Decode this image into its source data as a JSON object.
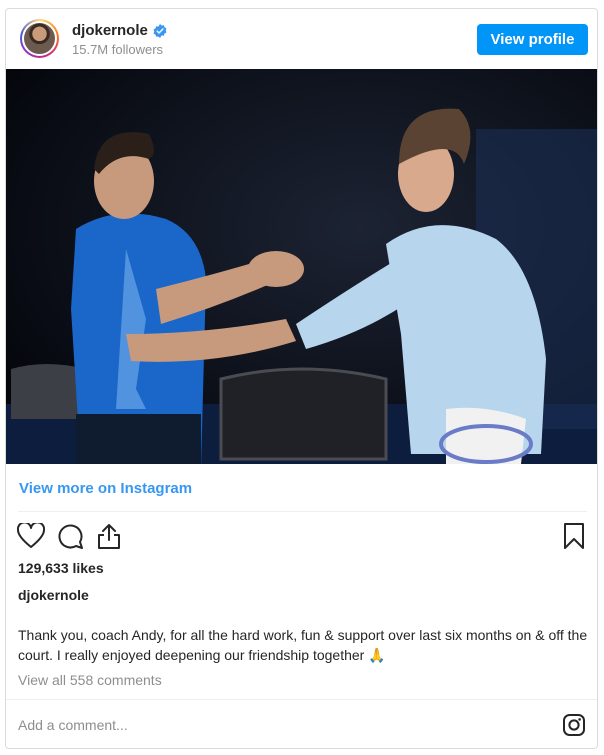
{
  "header": {
    "username": "djokernole",
    "followers": "15.7M followers",
    "view_profile_label": "View profile"
  },
  "post": {
    "view_more_label": "View more on Instagram",
    "likes": "129,633 likes",
    "owner": "djokernole",
    "caption": "Thank you, coach Andy, for all the hard work, fun & support over last six months on & off the court. I really enjoyed deepening our friendship together 🙏",
    "view_comments_label": "View all 558 comments"
  },
  "comment": {
    "placeholder": "Add a comment..."
  },
  "icons": {
    "verified": "verified-badge-icon",
    "like": "heart-icon",
    "comment": "comment-bubble-icon",
    "share": "share-icon",
    "save": "bookmark-icon",
    "instagram": "instagram-logo-icon"
  },
  "colors": {
    "accent": "#0095f6",
    "link": "#3897f0",
    "muted": "#8e8e8e"
  }
}
